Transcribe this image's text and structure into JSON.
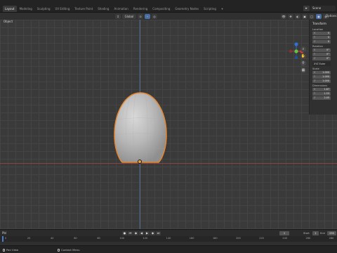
{
  "workspaces": [
    "Layout",
    "Modeling",
    "Sculpting",
    "UV Editing",
    "Texture Paint",
    "Shading",
    "Animation",
    "Rendering",
    "Compositing",
    "Geometry Nodes",
    "Scripting",
    "+"
  ],
  "active_workspace": "Layout",
  "scene_name": "Scene",
  "viewport_header": {
    "orientation": "Global",
    "options_label": "Options"
  },
  "viewport": {
    "view_label": "Object"
  },
  "npanel": {
    "section": "Transform",
    "location_label": "Location",
    "location": [
      {
        "axis": "X",
        "value": "0"
      },
      {
        "axis": "Y",
        "value": "0"
      },
      {
        "axis": "Z",
        "value": "0"
      }
    ],
    "rotation_label": "Rotation",
    "rotation": [
      {
        "axis": "X",
        "value": "0°"
      },
      {
        "axis": "Y",
        "value": "0°"
      },
      {
        "axis": "Z",
        "value": "0°"
      }
    ],
    "rotation_mode": "XYZ Euler",
    "scale_label": "Scale",
    "scale": [
      {
        "axis": "X",
        "value": "1.000"
      },
      {
        "axis": "Y",
        "value": "1.000"
      },
      {
        "axis": "Z",
        "value": "1.000"
      }
    ],
    "dimensions_label": "Dimensions",
    "dimensions": [
      {
        "axis": "X",
        "value": "1.67"
      },
      {
        "axis": "Y",
        "value": "1.53"
      },
      {
        "axis": "Z",
        "value": "2.05"
      }
    ]
  },
  "timeline": {
    "menu_label": "Pbl",
    "current_frame": "1",
    "start_label": "Start",
    "start": "1",
    "end_label": "End",
    "end": "250",
    "ticks": [
      "0",
      "20",
      "40",
      "60",
      "80",
      "100",
      "120",
      "140",
      "160",
      "180",
      "200",
      "220",
      "240",
      "260",
      "280"
    ]
  },
  "statusbar": {
    "select_label": "Pan View",
    "context_label": "Context Menu"
  },
  "colors": {
    "selection_outline": "#e8862a",
    "x_axis": "#8a4343",
    "z_axis": "#4f6f93",
    "active_blue": "#4a6fa3"
  }
}
